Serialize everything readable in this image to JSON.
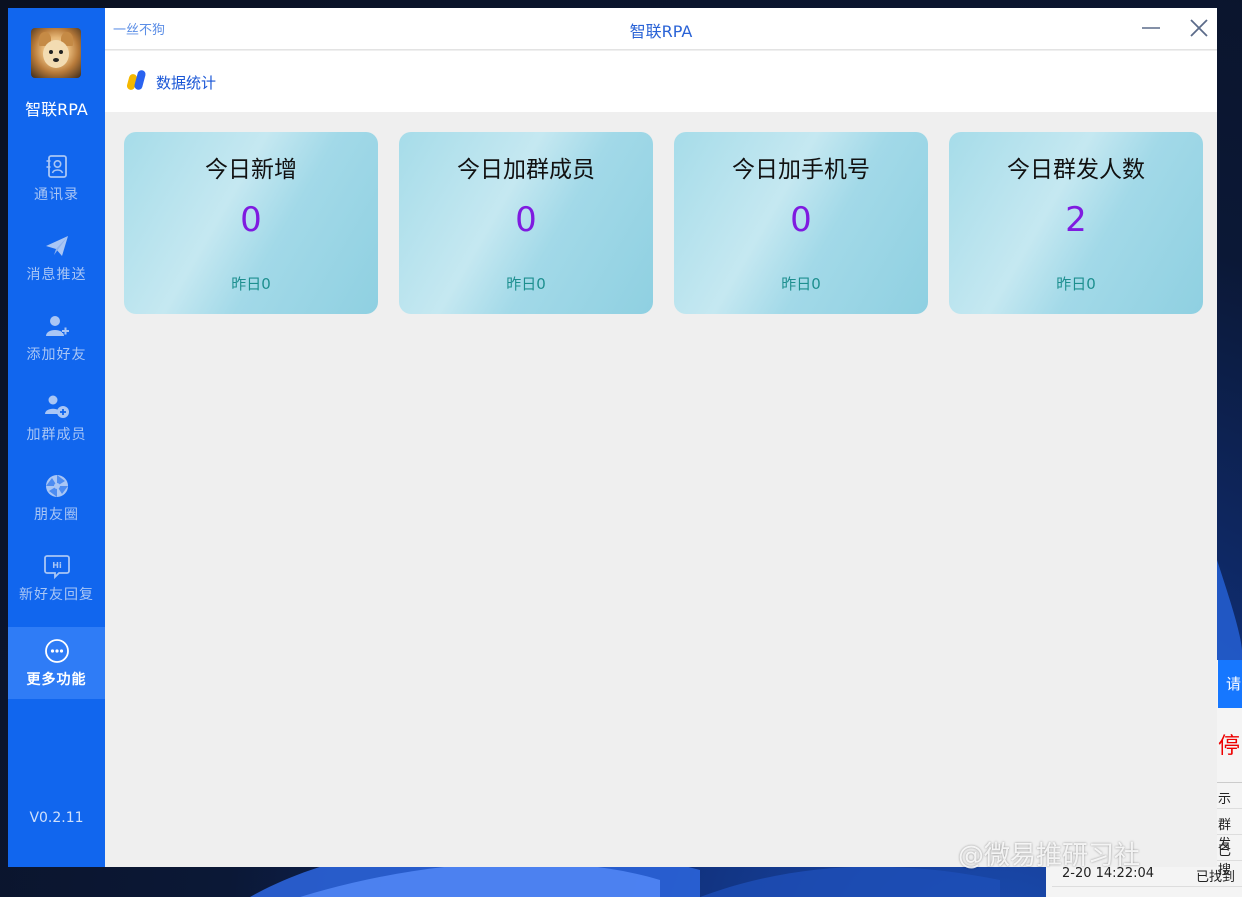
{
  "app": {
    "name": "智联RPA",
    "version": "V0.2.11",
    "user": "一丝不狗"
  },
  "sidebar": {
    "items": [
      {
        "label": "通讯录",
        "icon": "contacts-icon"
      },
      {
        "label": "消息推送",
        "icon": "send-icon"
      },
      {
        "label": "添加好友",
        "icon": "add-friend-icon"
      },
      {
        "label": "加群成员",
        "icon": "add-group-member-icon"
      },
      {
        "label": "朋友圈",
        "icon": "moments-icon"
      },
      {
        "label": "新好友回复",
        "icon": "hi-reply-icon"
      },
      {
        "label": "更多功能",
        "icon": "more-icon",
        "active": true
      }
    ]
  },
  "window": {
    "title": "智联RPA"
  },
  "header": {
    "section_label": "数据统计"
  },
  "stats": [
    {
      "title": "今日新增",
      "value": "0",
      "sub": "昨日0"
    },
    {
      "title": "今日加群成员",
      "value": "0",
      "sub": "昨日0"
    },
    {
      "title": "今日加手机号",
      "value": "0",
      "sub": "昨日0"
    },
    {
      "title": "今日群发人数",
      "value": "2",
      "sub": "昨日0"
    }
  ],
  "background_window": {
    "button_text": "请",
    "stop_text": "停",
    "column_text": "示",
    "rows": [
      {
        "time": "",
        "status": "群发"
      },
      {
        "time": "",
        "status": "已搜"
      },
      {
        "time": "2-20 14:22:04",
        "status": "已找到"
      }
    ]
  },
  "watermark": "@微易推研习社",
  "colors": {
    "sidebar": "#1166ee",
    "accent": "#2a63d6",
    "value": "#7f1be0",
    "sub": "#1d8f8f"
  }
}
